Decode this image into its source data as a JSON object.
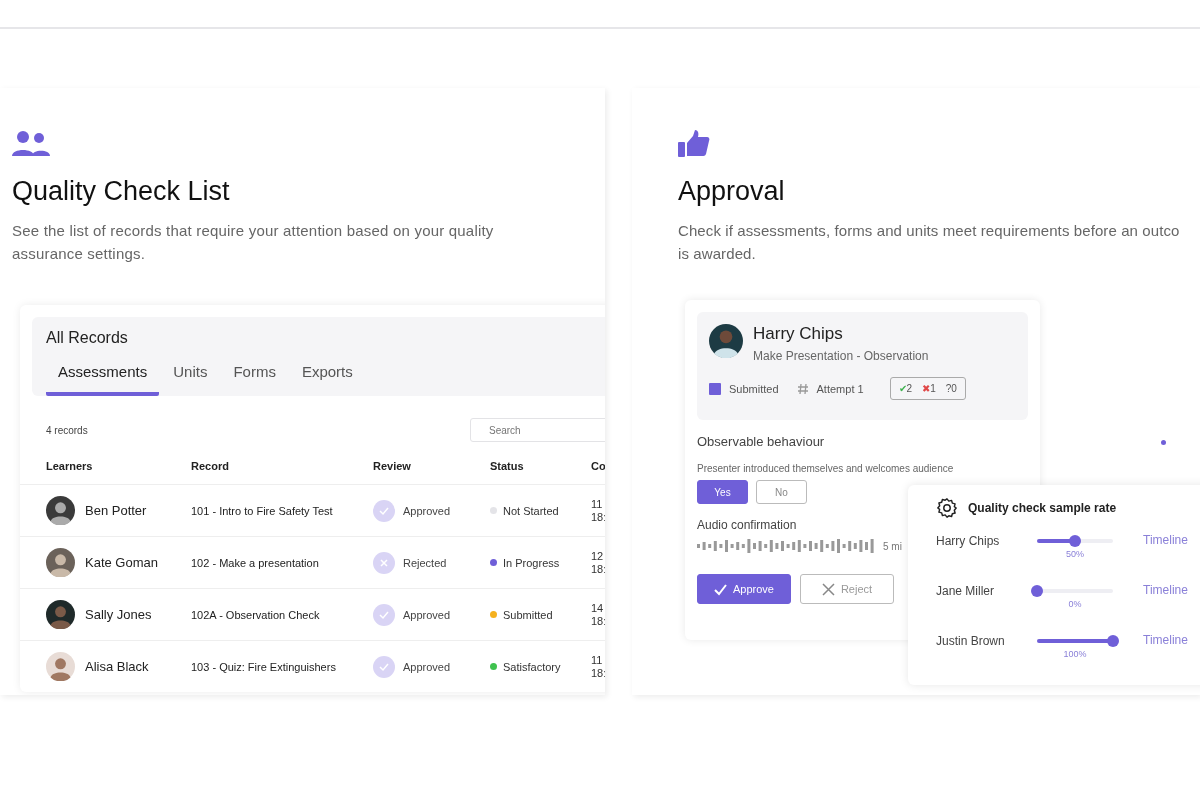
{
  "left_panel": {
    "title": "Quality Check List",
    "description": "See the list of records that require your attention based on your quality assurance settings.",
    "records": {
      "title": "All Records",
      "tabs": [
        {
          "label": "Assessments",
          "selected": true
        },
        {
          "label": "Units",
          "selected": false
        },
        {
          "label": "Forms",
          "selected": false
        },
        {
          "label": "Exports",
          "selected": false
        }
      ],
      "count": "4 records",
      "search": {
        "placeholder": "Search"
      },
      "columns": [
        "Learners",
        "Record",
        "Review",
        "Status",
        "Co"
      ],
      "rows": [
        {
          "learner": "Ben Potter",
          "record": "101 - Intro to Fire Safety Test",
          "review": {
            "kind": "approved",
            "label": "Approved"
          },
          "status": {
            "label": "Not Started",
            "color": "#e4e4e8"
          },
          "column_5": [
            "11",
            "18:"
          ]
        },
        {
          "learner": "Kate Goman",
          "record": "102 - Make a presentation",
          "review": {
            "kind": "rejected",
            "label": "Rejected"
          },
          "status": {
            "label": "In Progress",
            "color": "#6f5fd8"
          },
          "column_5": [
            "12",
            "18:"
          ]
        },
        {
          "learner": "Sally Jones",
          "record": "102A - Observation Check",
          "review": {
            "kind": "approved",
            "label": "Approved"
          },
          "status": {
            "label": "Submitted",
            "color": "#f5b11e"
          },
          "column_5": [
            "14",
            "18:"
          ]
        },
        {
          "learner": "Alisa Black",
          "record": "103 - Quiz: Fire Extinguishers",
          "review": {
            "kind": "approved",
            "label": "Approved"
          },
          "status": {
            "label": "Satisfactory",
            "color": "#3fc24f"
          },
          "column_5": [
            "11",
            "18:"
          ]
        }
      ]
    }
  },
  "right_panel": {
    "title": "Approval",
    "description_lines": [
      "Check if assessments, forms and units meet requirements before an outco",
      "is awarded."
    ],
    "approval_card": {
      "name": "Harry Chips",
      "subtitle": "Make Presentation - Observation",
      "status": "Submitted",
      "attempt": "Attempt 1",
      "counts": [
        {
          "kind": "pass",
          "symbol": "✔",
          "count": "2"
        },
        {
          "kind": "fail",
          "symbol": "✖",
          "count": "1"
        },
        {
          "kind": "unknown",
          "symbol": "?",
          "count": "0"
        }
      ],
      "section": "Observable behaviour",
      "question": "Presenter introduced themselves and welcomes audience",
      "answers": [
        {
          "label": "Yes",
          "selected": true
        },
        {
          "label": "No",
          "selected": false
        }
      ],
      "audio_label": "Audio confirmation",
      "audio_length": "5 mi",
      "buttons": [
        {
          "kind": "approve",
          "label": "Approve"
        },
        {
          "kind": "reject",
          "label": "Reject"
        }
      ]
    },
    "sample_rate": {
      "title": "Quality check sample rate",
      "rows": [
        {
          "name": "Harry Chips",
          "level": 0.5,
          "reading": "50%",
          "link": "Timeline"
        },
        {
          "name": "Jane Miller",
          "level": 0,
          "reading": "0%",
          "link": "Timeline"
        },
        {
          "name": "Justin Brown",
          "level": 1,
          "reading": "100%",
          "link": "Timeline"
        }
      ]
    }
  }
}
